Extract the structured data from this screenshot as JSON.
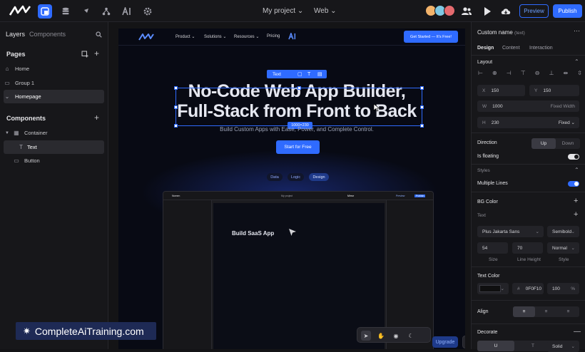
{
  "topbar": {
    "project_label": "My project",
    "web_label": "Web",
    "preview_label": "Preview",
    "publish_label": "Publish"
  },
  "left_panel": {
    "tab_layers": "Layers",
    "tab_components": "Components",
    "pages_heading": "Pages",
    "pages": [
      "Home",
      "Group 1",
      "Homepage"
    ],
    "components_heading": "Components",
    "components": [
      "Container",
      "Text",
      "Button"
    ]
  },
  "site": {
    "nav": [
      "Product",
      "Solutions",
      "Resources",
      "Pricing"
    ],
    "nav_cta": "Get Started — It's Free!",
    "hero_line1": "No-Code Web App Builder,",
    "hero_line2": "Full-Stack from Front to Back",
    "subtitle": "Build Custom Apps with Ease, Power, and Complete Control.",
    "start_button": "Start for Free",
    "pills": [
      "Data",
      "Logic",
      "Design"
    ],
    "selection_tag": "Text",
    "selection_dims": "1000×230",
    "mini_hero": "Build SaaS App",
    "mini_project": "My project",
    "mini_mirror": "Mirror",
    "mini_preview": "Preview",
    "mini_publish": "Publish"
  },
  "canvas_tools": {
    "upgrade_label": "Upgrade",
    "help_label": "?"
  },
  "watermark": "CompleteAiTraining.com",
  "right_panel": {
    "element_name": "Custom name",
    "element_type": "(text)",
    "tabs": [
      "Design",
      "Content",
      "Interaction"
    ],
    "layout_heading": "Layout",
    "x_label": "X",
    "x_value": "150",
    "y_label": "Y",
    "y_value": "150",
    "w_label": "W",
    "w_value": "1000",
    "w_mode": "Fixed Width",
    "h_label": "H",
    "h_value": "230",
    "h_mode": "Fixed",
    "direction_label": "Direction",
    "direction_options": [
      "Up",
      "Down"
    ],
    "floating_label": "Is floating",
    "styles_label": "Styles",
    "multiline_label": "Multiple Lines",
    "bg_color_label": "BG Color",
    "text_label": "Text",
    "font_family": "Plus Jakarta Sans",
    "font_weight": "Semibold",
    "font_size": "54",
    "line_height": "70",
    "style_value": "Normal",
    "size_caption": "Size",
    "line_height_caption": "Line Height",
    "style_caption": "Style",
    "text_color_label": "Text Color",
    "color_hex": "0F0F10",
    "color_hash": "#",
    "opacity_value": "100",
    "opacity_unit": "%",
    "align_label": "Align",
    "decorate_label": "Decorate",
    "decorate_style": "Solid"
  },
  "colors": {
    "accent": "#2f6bff",
    "panel": "#17171a",
    "canvas": "#141416"
  }
}
